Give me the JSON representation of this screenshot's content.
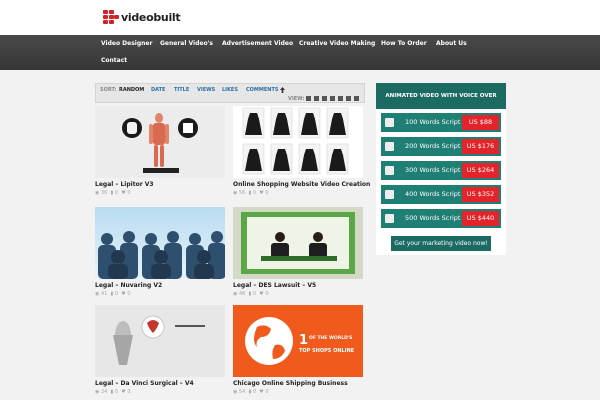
{
  "logo": {
    "text": "videobuilt"
  },
  "nav": {
    "items": [
      "Video Designer",
      "General Video's",
      "Advertisement Video",
      "Creative Video Making",
      "How To Order",
      "About Us"
    ],
    "contact": "Contact"
  },
  "sort": {
    "label": "SORT:",
    "items": [
      "RANDOM",
      "DATE",
      "TITLE",
      "VIEWS",
      "LIKES",
      "COMMENTS"
    ],
    "view_label": "VIEW:"
  },
  "videos": [
    {
      "title": "Legal – Lipitor V3",
      "views": "36",
      "comments": "0",
      "likes": "0"
    },
    {
      "title": "Online Shopping Website Video Creation",
      "views": "56",
      "comments": "0",
      "likes": "0"
    },
    {
      "title": "Legal – Nuvaring V2",
      "views": "41",
      "comments": "0",
      "likes": "0"
    },
    {
      "title": "Legal – DES Lawsuit – V5",
      "views": "46",
      "comments": "0",
      "likes": "0"
    },
    {
      "title": "Legal – Da Vinci Surgical – V4",
      "views": "24",
      "comments": "0",
      "likes": "0"
    },
    {
      "title": "Chicago Online Shipping Business",
      "views": "54",
      "comments": "0",
      "likes": "0"
    }
  ],
  "thumb_text": {
    "world_big": "1",
    "world_line1": "OF THE WORLD'S",
    "world_line2": "TOP SHOPS ONLINE"
  },
  "pricing": {
    "heading": "ANIMATED VIDEO WITH VOICE OVER PRICE",
    "rows": [
      {
        "words": "100 Words Script",
        "price": "US $88"
      },
      {
        "words": "200 Words Script",
        "price": "US $176"
      },
      {
        "words": "300 Words Script",
        "price": "US $264"
      },
      {
        "words": "400 Words Script",
        "price": "US $352"
      },
      {
        "words": "500 Words Script",
        "price": "US $440"
      }
    ],
    "cta": "Get your marketing video now!"
  },
  "colors": {
    "accent_red": "#e3242b",
    "teal": "#1b6b63",
    "nav_bg": "#3f3f3f",
    "link_blue": "#2a6fa8"
  }
}
